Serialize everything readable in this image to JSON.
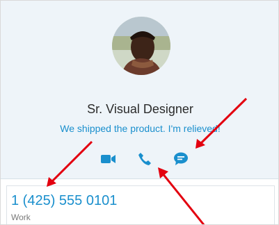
{
  "profile": {
    "job_title": "Sr. Visual Designer",
    "mood_message": "We shipped the product. I'm relieved!",
    "avatar_icon": "user-avatar"
  },
  "actions": [
    {
      "name": "video-call",
      "icon": "video-camera-icon"
    },
    {
      "name": "audio-call",
      "icon": "phone-icon"
    },
    {
      "name": "send-message",
      "icon": "chat-bubble-icon"
    }
  ],
  "contact": {
    "phone": "1 (425) 555 0101",
    "type": "Work"
  },
  "colors": {
    "accent": "#1a8fcd",
    "annotation_arrow": "#e3000f",
    "card_background": "#eef4f9"
  }
}
